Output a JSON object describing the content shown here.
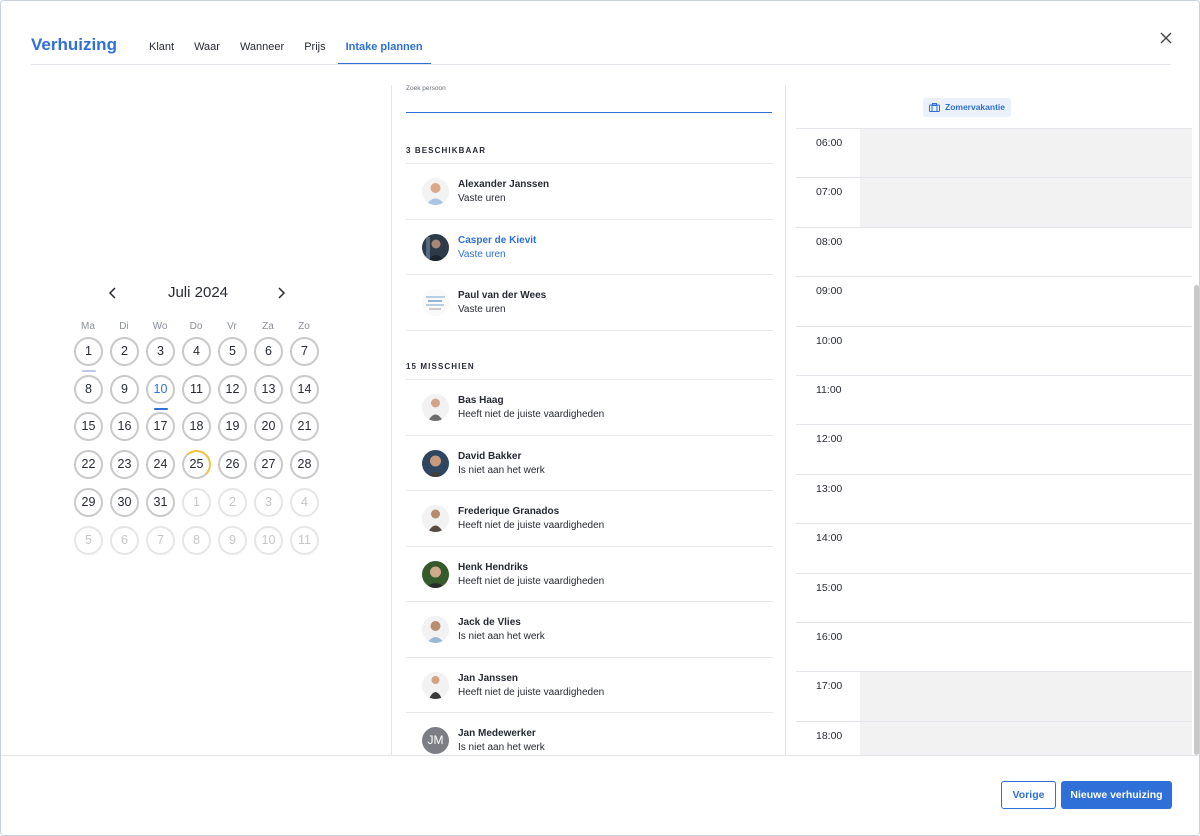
{
  "header": {
    "title": "Verhuizing",
    "tabs": [
      {
        "label": "Klant",
        "active": false
      },
      {
        "label": "Waar",
        "active": false
      },
      {
        "label": "Wanneer",
        "active": false
      },
      {
        "label": "Prijs",
        "active": false
      },
      {
        "label": "Intake plannen",
        "active": true
      }
    ]
  },
  "calendar": {
    "month_label": "Juli 2024",
    "weekdays": [
      "Ma",
      "Di",
      "Wo",
      "Do",
      "Vr",
      "Za",
      "Zo"
    ],
    "weeks": [
      [
        "1",
        "2",
        "3",
        "4",
        "5",
        "6",
        "7"
      ],
      [
        "8",
        "9",
        "10",
        "11",
        "12",
        "13",
        "14"
      ],
      [
        "15",
        "16",
        "17",
        "18",
        "19",
        "20",
        "21"
      ],
      [
        "22",
        "23",
        "24",
        "25",
        "26",
        "27",
        "28"
      ],
      [
        "29",
        "30",
        "31",
        "1",
        "2",
        "3",
        "4"
      ],
      [
        "5",
        "6",
        "7",
        "8",
        "9",
        "10",
        "11"
      ]
    ],
    "today": "10",
    "selected_day": "10",
    "accent_color": "#2f6fd8",
    "partial_color": "#f0c33c"
  },
  "search": {
    "label": "Zoek persoon",
    "value": ""
  },
  "available": {
    "heading": "3 BESCHIKBAAR",
    "people": [
      {
        "name": "Alexander Janssen",
        "status": "Vaste uren",
        "selected": false
      },
      {
        "name": "Casper de Kievit",
        "status": "Vaste uren",
        "selected": true
      },
      {
        "name": "Paul van der Wees",
        "status": "Vaste uren",
        "selected": false
      }
    ]
  },
  "maybe": {
    "heading": "15 MISSCHIEN",
    "people": [
      {
        "name": "Bas Haag",
        "status": "Heeft niet de juiste vaardigheden"
      },
      {
        "name": "David Bakker",
        "status": "Is niet aan het werk"
      },
      {
        "name": "Frederique Granados",
        "status": "Heeft niet de juiste vaardigheden"
      },
      {
        "name": "Henk Hendriks",
        "status": "Heeft niet de juiste vaardigheden"
      },
      {
        "name": "Jack de Vlies",
        "status": "Is niet aan het werk"
      },
      {
        "name": "Jan Janssen",
        "status": "Heeft niet de juiste vaardigheden"
      },
      {
        "name": "Jan Medewerker",
        "status": "Is niet aan het werk",
        "initials": "JM"
      }
    ]
  },
  "schedule": {
    "holiday_label": "Zomervakantie",
    "hours": [
      {
        "label": "06:00",
        "unavailable": true
      },
      {
        "label": "07:00",
        "unavailable": true
      },
      {
        "label": "08:00",
        "unavailable": false
      },
      {
        "label": "09:00",
        "unavailable": false
      },
      {
        "label": "10:00",
        "unavailable": false
      },
      {
        "label": "11:00",
        "unavailable": false
      },
      {
        "label": "12:00",
        "unavailable": false
      },
      {
        "label": "13:00",
        "unavailable": false
      },
      {
        "label": "14:00",
        "unavailable": false
      },
      {
        "label": "15:00",
        "unavailable": false
      },
      {
        "label": "16:00",
        "unavailable": false
      },
      {
        "label": "17:00",
        "unavailable": true
      },
      {
        "label": "18:00",
        "unavailable": true
      }
    ]
  },
  "footer": {
    "prev_label": "Vorige",
    "next_label": "Nieuwe verhuizing"
  }
}
